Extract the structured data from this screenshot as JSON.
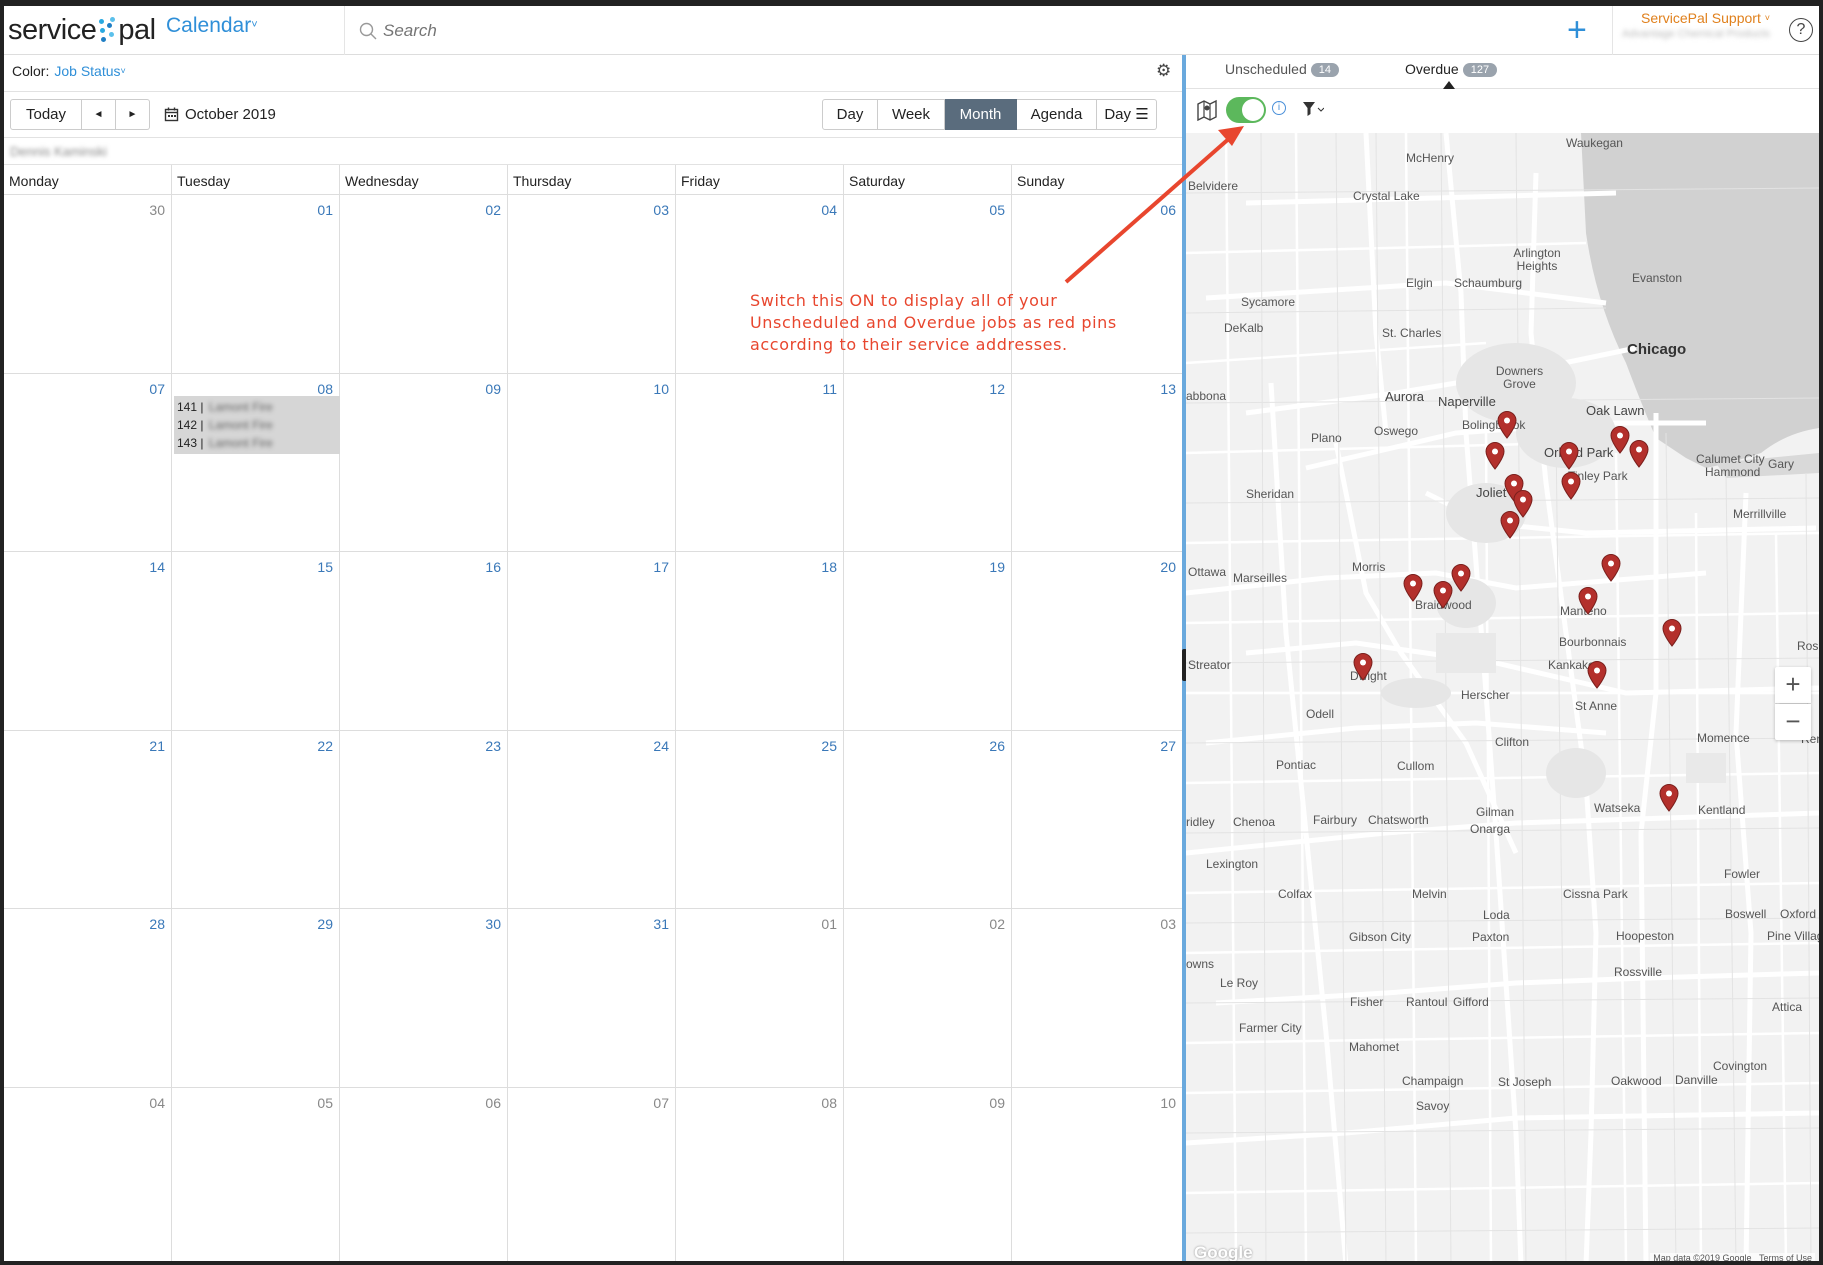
{
  "header": {
    "logo_left": "service",
    "logo_right": "pal",
    "app_title": "Calendar",
    "search_placeholder": "Search",
    "user_name": "ServicePal Support",
    "user_org": "Advantage Chemical Products",
    "help_label": "?",
    "new_label": "+"
  },
  "calendar": {
    "color_label": "Color:",
    "color_value": "Job Status",
    "today_label": "Today",
    "prev_label": "◄",
    "next_label": "►",
    "current_date": "October 2019",
    "views": [
      "Day",
      "Week",
      "Month",
      "Agenda",
      "Day"
    ],
    "active_view": "Month",
    "technician": "Dennis Kaminski",
    "weekdays": [
      "Monday",
      "Tuesday",
      "Wednesday",
      "Thursday",
      "Friday",
      "Saturday",
      "Sunday"
    ],
    "weeks": [
      [
        "30",
        "01",
        "02",
        "03",
        "04",
        "05",
        "06"
      ],
      [
        "07",
        "08",
        "09",
        "10",
        "11",
        "12",
        "13"
      ],
      [
        "14",
        "15",
        "16",
        "17",
        "18",
        "19",
        "20"
      ],
      [
        "21",
        "22",
        "23",
        "24",
        "25",
        "26",
        "27"
      ],
      [
        "28",
        "29",
        "30",
        "31",
        "01",
        "02",
        "03"
      ],
      [
        "04",
        "05",
        "06",
        "07",
        "08",
        "09",
        "10"
      ]
    ],
    "events": [
      {
        "id": "141",
        "customer": "Lamont Fire"
      },
      {
        "id": "142",
        "customer": "Lamont Fire"
      },
      {
        "id": "143",
        "customer": "Lamont Fire"
      }
    ]
  },
  "panel": {
    "tab_unscheduled": "Unscheduled",
    "unscheduled_count": "14",
    "tab_overdue": "Overdue",
    "overdue_count": "127",
    "map_toggle_on": true,
    "info_label": "i"
  },
  "map": {
    "cities": [
      "Waukegan",
      "McHenry",
      "Belvidere",
      "Crystal Lake",
      "Arlington Heights",
      "Evanston",
      "Elgin",
      "Schaumburg",
      "Sycamore",
      "DeKalb",
      "St. Charles",
      "Chicago",
      "Downers Grove",
      "Aurora",
      "Naperville",
      "Oak Lawn",
      "abbona",
      "Oswego",
      "Bolingbrook",
      "Plano",
      "Orland Park",
      "Calumet City",
      "Hammond",
      "Gary",
      "Tinley Park",
      "Sheridan",
      "Joliet",
      "Merrillville",
      "Ottawa",
      "Marseilles",
      "Morris",
      "Braidwood",
      "Manteno",
      "Bourbonnais",
      "Streator",
      "Dwight",
      "Kankakee",
      "Herscher",
      "St Anne",
      "Odell",
      "Clifton",
      "Momence",
      "Pontiac",
      "Cullom",
      "ridley",
      "Chenoa",
      "Fairbury",
      "Chatsworth",
      "Gilman",
      "Watseka",
      "Kentland",
      "Onarga",
      "Lexington",
      "Fowler",
      "Colfax",
      "Melvin",
      "Cissna Park",
      "Boswell",
      "Oxford",
      "Loda",
      "Gibson City",
      "Paxton",
      "Hoopeston",
      "Pine Village",
      "owns",
      "Rossville",
      "Le Roy",
      "Fisher",
      "Rantoul",
      "Gifford",
      "Attica",
      "Farmer City",
      "Mahomet",
      "Covington",
      "Champaign",
      "St Joseph",
      "Oakwood",
      "Danville",
      "Savoy",
      "Ros",
      "Ren"
    ],
    "zoom_in": "+",
    "zoom_out": "−",
    "attribution": "Map data ©2019 Google",
    "terms": "Terms of Use",
    "google": "Google",
    "pins": 20
  },
  "annotation": {
    "text": "Switch this ON to display all of your Unscheduled and Overdue jobs as red pins according to their service addresses.",
    "color": "#e8462e"
  },
  "colors": {
    "accent": "#2f8fd8",
    "active_view": "#5a6c7d",
    "toggle_on": "#5cb85c",
    "pin": "#b3302c",
    "user": "#e0801c"
  }
}
